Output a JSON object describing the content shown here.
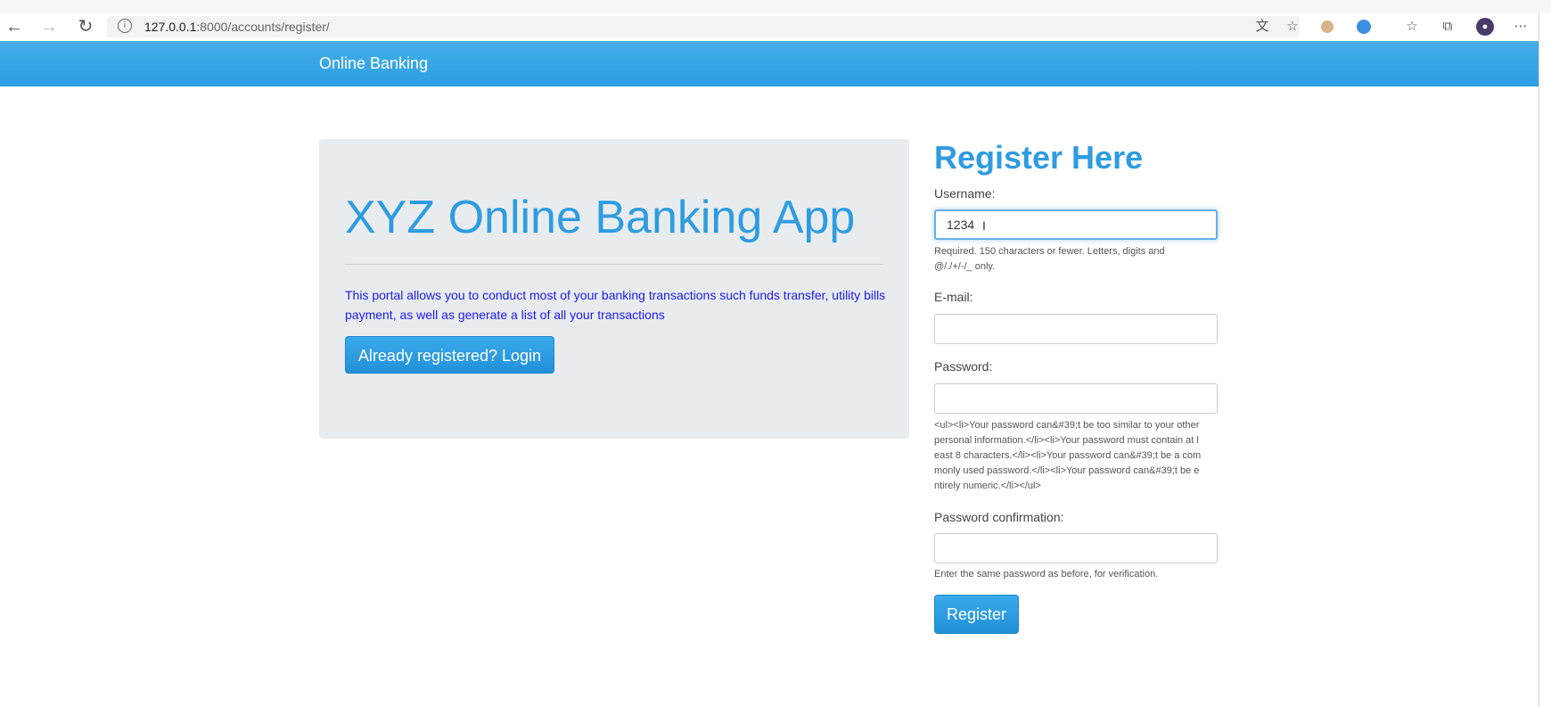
{
  "browser": {
    "url_host": "127.0.0.1",
    "url_rest": ":8000/accounts/register/",
    "back_icon": "←",
    "forward_icon": "→",
    "reload_icon": "↻",
    "info_icon": "i"
  },
  "navbar": {
    "brand": "Online Banking",
    "color": "#2c9ee2"
  },
  "jumbotron": {
    "title": "XYZ Online Banking App",
    "description": "This portal allows you to conduct most of your banking transactions such funds transfer, utility bills payment, as well as generate a list of all your transactions",
    "login_button": "Already registered? Login"
  },
  "register": {
    "title": "Register Here",
    "username_label": "Username:",
    "username_value": "1234",
    "username_help": "Required. 150 characters or fewer. Letters, digits and @/./+/-/_ only.",
    "email_label": "E-mail:",
    "email_value": "",
    "password_label": "Password:",
    "password_value": "",
    "password_help": "<ul><li>Your password can&#39;t be too similar to your other personal information.</li><li>Your password must contain at least 8 characters.</li><li>Your password can&#39;t be a commonly used password.</li><li>Your password can&#39;t be entirely numeric.</li></ul>",
    "confirm_label": "Password confirmation:",
    "confirm_value": "",
    "confirm_help": "Enter the same password as before, for verification.",
    "submit_button": "Register"
  }
}
